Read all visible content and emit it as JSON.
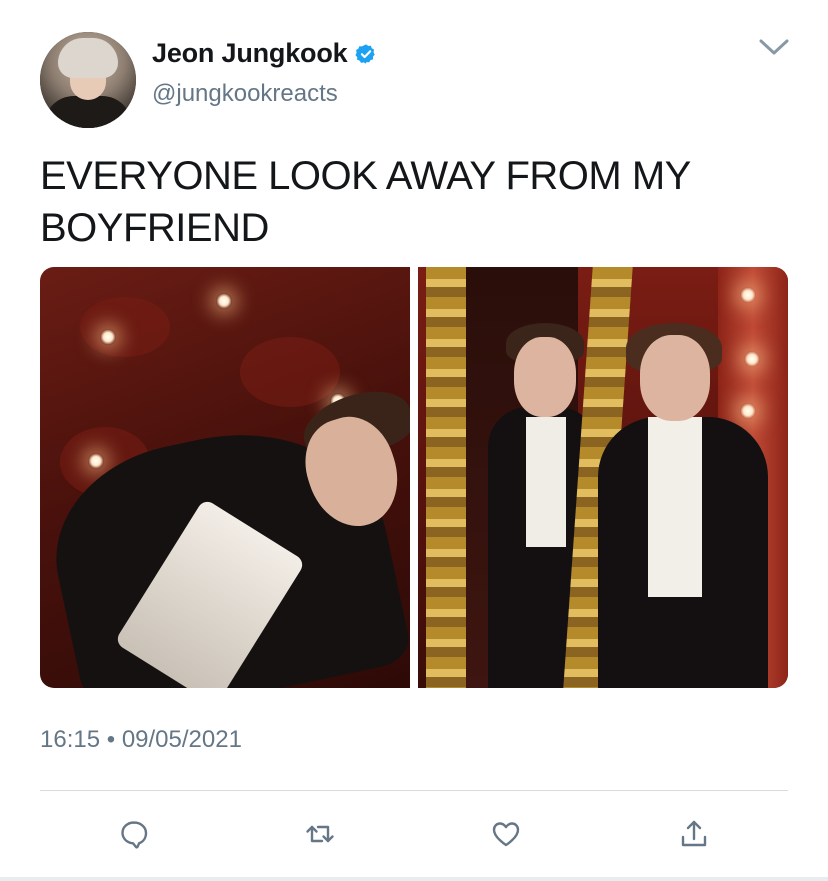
{
  "author": {
    "display_name": "Jeon Jungkook",
    "handle": "@jungkookreacts",
    "verified": true
  },
  "tweet": {
    "text": "EVERYONE LOOK AWAY FROM MY BOYFRIEND",
    "time": "16:15",
    "separator": "•",
    "date": "09/05/2021"
  },
  "icons": {
    "verified": "verified-badge-icon",
    "more": "chevron-down-icon",
    "reply": "reply-icon",
    "retweet": "retweet-icon",
    "like": "heart-icon",
    "share": "share-icon"
  },
  "colors": {
    "text": "#14171a",
    "secondary": "#657786",
    "verified": "#1da1f2",
    "divider": "#d7dbdf"
  }
}
